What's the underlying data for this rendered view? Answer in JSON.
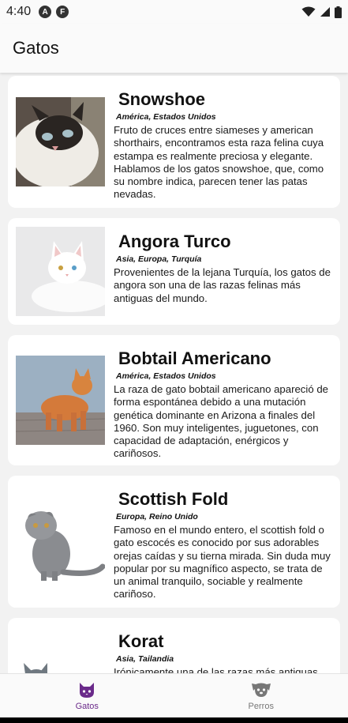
{
  "status_bar": {
    "time": "4:40",
    "notif_a": "A",
    "notif_b": "F"
  },
  "app_bar": {
    "title": "Gatos"
  },
  "cats": [
    {
      "name": "Snowshoe",
      "origin": "América, Estados Unidos",
      "description": "Fruto de cruces entre siameses y american shorthairs, encontramos esta raza felina cuya estampa es realmente preciosa y elegante. Hablamos de los gatos snowshoe, que, como su nombre indica, parecen tener las patas nevadas."
    },
    {
      "name": "Angora Turco",
      "origin": "Asia, Europa, Turquía",
      "description": "Provenientes de la lejana Turquía, los gatos de angora son una de las razas felinas más antiguas del mundo."
    },
    {
      "name": "Bobtail Americano",
      "origin": "América, Estados Unidos",
      "description": "La raza de gato bobtail americano apareció de forma espontánea debido a una mutación genética dominante en Arizona a finales del 1960. Son muy inteligentes, juguetones, con capacidad de adaptación, enérgicos y cariñosos."
    },
    {
      "name": "Scottish Fold",
      "origin": "Europa, Reino Unido",
      "description": "Famoso en el mundo entero, el scottish fold o gato escocés es conocido por sus adorables orejas caídas y su tierna mirada. Sin duda muy popular por su magnífico aspecto, se trata de un animal tranquilo, sociable y realmente cariñoso."
    },
    {
      "name": "Korat",
      "origin": "Asia, Tailandia",
      "description": "Irónicamente una de las razas más antiguas"
    }
  ],
  "bottom_nav": {
    "tabs": [
      {
        "label": "Gatos",
        "icon": "cat-icon",
        "active": true
      },
      {
        "label": "Perros",
        "icon": "dog-icon",
        "active": false
      }
    ],
    "active_color": "#6a2a8a",
    "inactive_color": "#777777"
  }
}
